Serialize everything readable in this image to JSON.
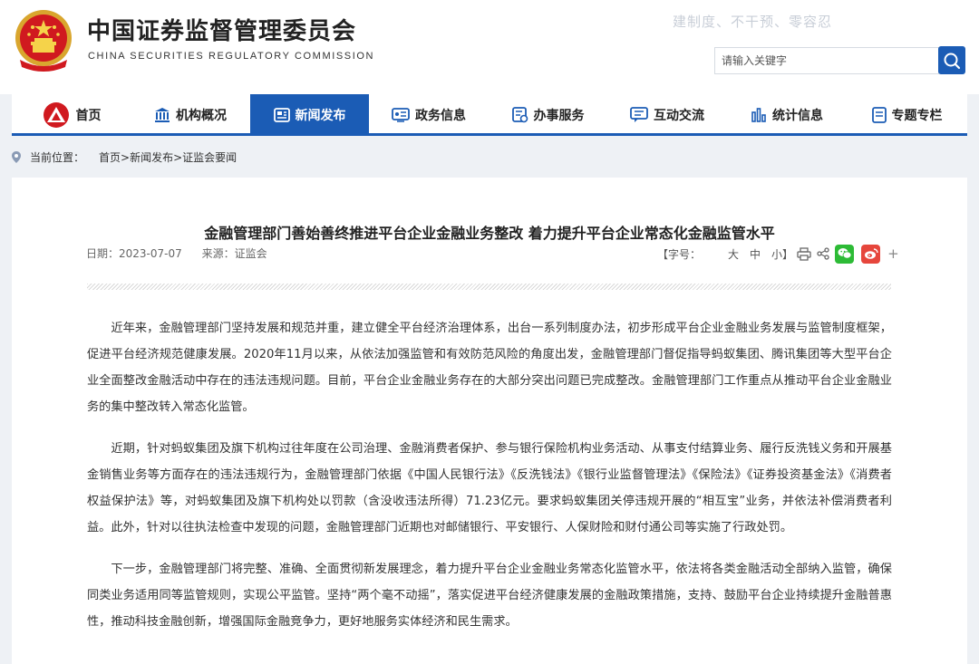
{
  "header": {
    "title_cn": "中国证券监督管理委员会",
    "title_en": "CHINA SECURITIES REGULATORY COMMISSION",
    "slogan": "建制度、不干预、零容忍",
    "search_placeholder": "请输入关键字",
    "search_icon": "search-icon"
  },
  "nav": {
    "items": [
      {
        "label": "首页",
        "icon": "home-logo-icon",
        "active": false
      },
      {
        "label": "机构概况",
        "icon": "building-icon",
        "active": false
      },
      {
        "label": "新闻发布",
        "icon": "newspaper-icon",
        "active": true
      },
      {
        "label": "政务信息",
        "icon": "info-screen-icon",
        "active": false
      },
      {
        "label": "办事服务",
        "icon": "service-icon",
        "active": false
      },
      {
        "label": "互动交流",
        "icon": "chat-icon",
        "active": false
      },
      {
        "label": "统计信息",
        "icon": "bar-chart-icon",
        "active": false
      },
      {
        "label": "专题专栏",
        "icon": "document-icon",
        "active": false
      }
    ],
    "accent": "#1b5cb5"
  },
  "breadcrumb": {
    "label": "当前位置：",
    "path": "首页>新闻发布>证监会要闻"
  },
  "article": {
    "title": "金融管理部门善始善终推进平台企业金融业务整改 着力提升平台企业常态化金融监管水平",
    "date": "日期：2023-07-07",
    "source": "来源：证监会",
    "font_label": "【字号：",
    "font_large": "大",
    "font_medium": "中",
    "font_small": "小】",
    "more": "+",
    "paragraphs": [
      "近年来，金融管理部门坚持发展和规范并重，建立健全平台经济治理体系，出台一系列制度办法，初步形成平台企业金融业务发展与监管制度框架，促进平台经济规范健康发展。2020年11月以来，从依法加强监管和有效防范风险的角度出发，金融管理部门督促指导蚂蚁集团、腾讯集团等大型平台企业全面整改金融活动中存在的违法违规问题。目前，平台企业金融业务存在的大部分突出问题已完成整改。金融管理部门工作重点从推动平台企业金融业务的集中整改转入常态化监管。",
      "近期，针对蚂蚁集团及旗下机构过往年度在公司治理、金融消费者保护、参与银行保险机构业务活动、从事支付结算业务、履行反洗钱义务和开展基金销售业务等方面存在的违法违规行为，金融管理部门依据《中国人民银行法》《反洗钱法》《银行业监督管理法》《保险法》《证券投资基金法》《消费者权益保护法》等，对蚂蚁集团及旗下机构处以罚款（含没收违法所得）71.23亿元。要求蚂蚁集团关停违规开展的“相互宝”业务，并依法补偿消费者利益。此外，针对以往执法检查中发现的问题，金融管理部门近期也对邮储银行、平安银行、人保财险和财付通公司等实施了行政处罚。",
      "下一步，金融管理部门将完整、准确、全面贯彻新发展理念，着力提升平台企业金融业务常态化监管水平，依法将各类金融活动全部纳入监管，确保同类业务适用同等监管规则，实现公平监管。坚持“两个毫不动摇”，落实促进平台经济健康发展的金融政策措施，支持、鼓励平台企业持续提升金融普惠性，推动科技金融创新，增强国际金融竞争力，更好地服务实体经济和民生需求。"
    ]
  }
}
